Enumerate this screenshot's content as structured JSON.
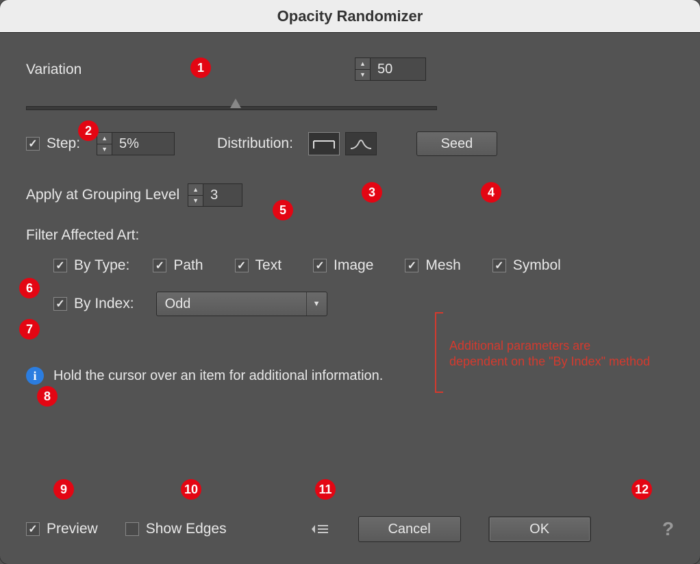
{
  "title": "Opacity Randomizer",
  "variation": {
    "label": "Variation",
    "value": "50"
  },
  "step": {
    "label": "Step:",
    "value": "5%",
    "checked": true
  },
  "distribution": {
    "label": "Distribution:"
  },
  "seed": {
    "label": "Seed"
  },
  "grouping": {
    "label": "Apply at Grouping Level",
    "value": "3"
  },
  "filter": {
    "title": "Filter Affected Art:",
    "byType": {
      "label": "By Type:",
      "checked": true,
      "options": [
        {
          "label": "Path",
          "checked": true
        },
        {
          "label": "Text",
          "checked": true
        },
        {
          "label": "Image",
          "checked": true
        },
        {
          "label": "Mesh",
          "checked": true
        },
        {
          "label": "Symbol",
          "checked": true
        }
      ]
    },
    "byIndex": {
      "label": "By Index:",
      "checked": true,
      "value": "Odd"
    }
  },
  "annotation": {
    "line1": "Additional parameters are",
    "line2": "dependent on the \"By Index\" method"
  },
  "info": {
    "text": "Hold the cursor over an item for additional information."
  },
  "bottom": {
    "preview": {
      "label": "Preview",
      "checked": true
    },
    "showEdges": {
      "label": "Show Edges",
      "checked": false
    },
    "cancel": "Cancel",
    "ok": "OK"
  },
  "markers": [
    "1",
    "2",
    "3",
    "4",
    "5",
    "6",
    "7",
    "8",
    "9",
    "10",
    "11",
    "12"
  ]
}
